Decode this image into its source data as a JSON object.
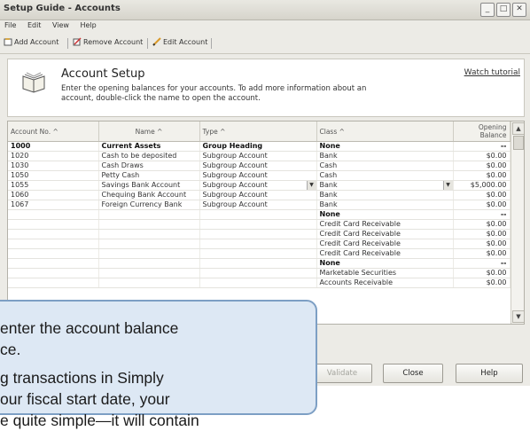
{
  "window": {
    "title": "Setup Guide - Accounts",
    "controls": [
      "_",
      "□",
      "✕"
    ]
  },
  "menu": [
    "File",
    "Edit",
    "View",
    "Help"
  ],
  "toolbar": {
    "add": "Add Account",
    "remove": "Remove Account",
    "edit": "Edit Account"
  },
  "header": {
    "title": "Account Setup",
    "desc": "Enter the opening balances for your accounts. To add more information about an account, double-click the name to open the account.",
    "watch": "Watch tutorial"
  },
  "columns": [
    "Account No. ^",
    "Name ^",
    "Type ^",
    "Class ^",
    "Opening Balance"
  ],
  "rows": [
    {
      "no": "1000",
      "name": "Current Assets",
      "type": "Group Heading",
      "cls": "None",
      "bal": "--",
      "bold": true
    },
    {
      "no": "1020",
      "name": "Cash to be deposited",
      "type": "Subgroup Account",
      "cls": "Bank",
      "bal": "$0.00"
    },
    {
      "no": "1030",
      "name": "Cash Draws",
      "type": "Subgroup Account",
      "cls": "Cash",
      "bal": "$0.00"
    },
    {
      "no": "1050",
      "name": "Petty Cash",
      "type": "Subgroup Account",
      "cls": "Cash",
      "bal": "$0.00"
    },
    {
      "no": "1055",
      "name": "Savings Bank Account",
      "type": "Subgroup Account",
      "cls": "Bank",
      "bal": "$5,000.00",
      "dropdown": true
    },
    {
      "no": "1060",
      "name": "Chequing Bank Account",
      "type": "Subgroup Account",
      "cls": "Bank",
      "bal": "$0.00"
    },
    {
      "no": "1067",
      "name": "Foreign Currency Bank",
      "type": "Subgroup Account",
      "cls": "Bank",
      "bal": "$0.00"
    },
    {
      "no": "",
      "name": "",
      "type": "",
      "cls": "None",
      "bal": "--",
      "bold": true
    },
    {
      "no": "",
      "name": "",
      "type": "",
      "cls": "Credit Card Receivable",
      "bal": "$0.00"
    },
    {
      "no": "",
      "name": "",
      "type": "",
      "cls": "Credit Card Receivable",
      "bal": "$0.00"
    },
    {
      "no": "",
      "name": "",
      "type": "",
      "cls": "Credit Card Receivable",
      "bal": "$0.00"
    },
    {
      "no": "",
      "name": "",
      "type": "",
      "cls": "Credit Card Receivable",
      "bal": "$0.00"
    },
    {
      "no": "",
      "name": "",
      "type": "",
      "cls": "None",
      "bal": "--",
      "bold": true
    },
    {
      "no": "",
      "name": "",
      "type": "",
      "cls": "Marketable Securities",
      "bal": "$0.00"
    },
    {
      "no": "",
      "name": "",
      "type": "",
      "cls": "Accounts Receivable",
      "bal": "$0.00"
    }
  ],
  "buttons": {
    "validate": "Validate",
    "close": "Close",
    "help": "Help"
  },
  "callout": {
    "line1": "enter the account balance",
    "line2": "ce.",
    "line3": "g transactions in Simply",
    "line4": "our fiscal start date, your",
    "line5": "e quite simple—it will contain"
  }
}
